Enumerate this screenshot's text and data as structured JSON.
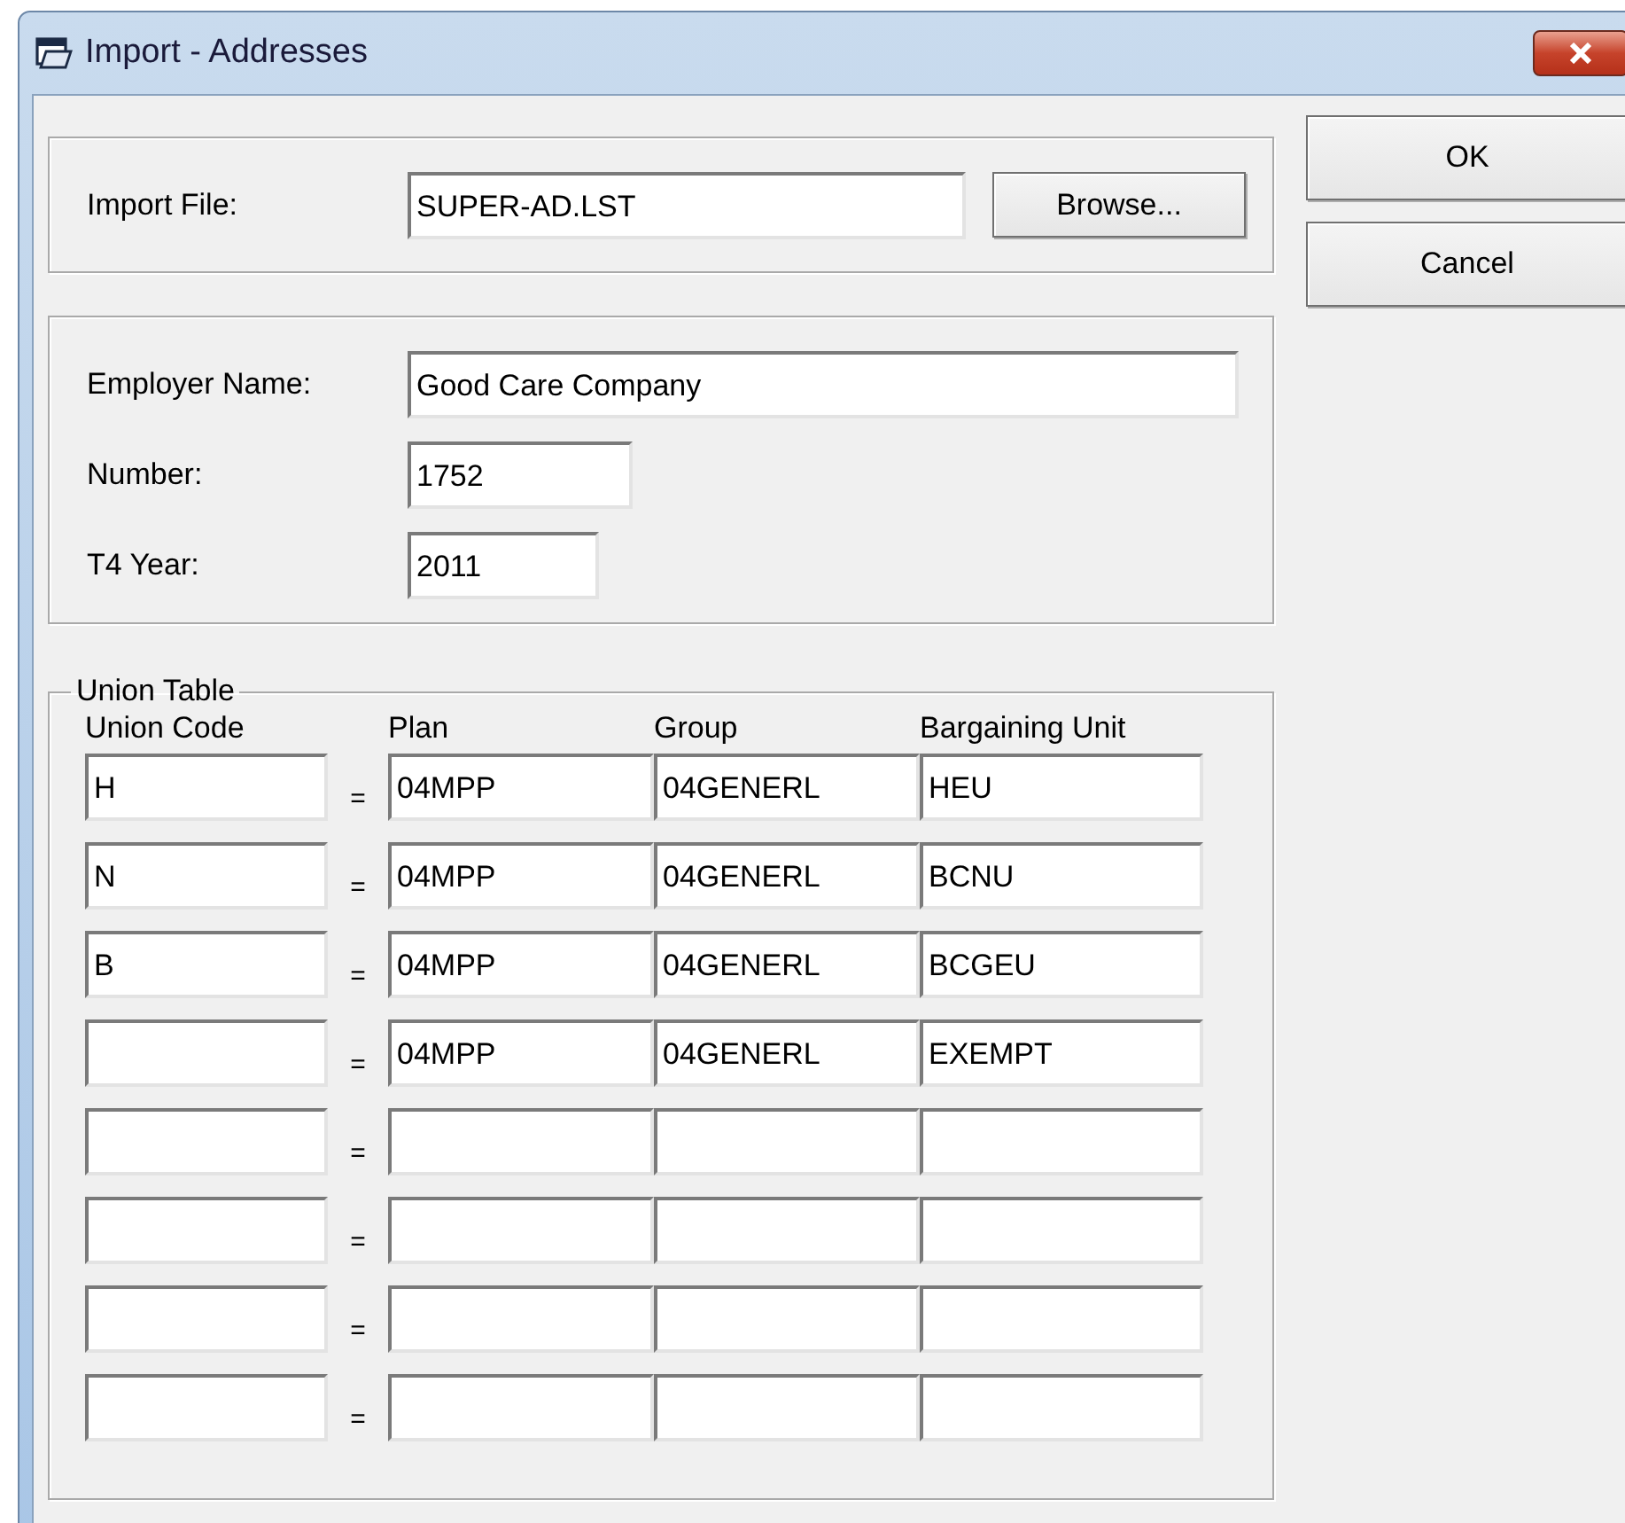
{
  "window": {
    "title": "Import - Addresses"
  },
  "import_file": {
    "label": "Import File:",
    "value": "SUPER-AD.LST",
    "browse_button": "Browse..."
  },
  "employer": {
    "name_label": "Employer Name:",
    "name": "Good Care Company",
    "number_label": "Number:",
    "number": "1752",
    "year_label": "T4 Year:",
    "year": "2011"
  },
  "union_table": {
    "title": "Union Table",
    "columns": [
      "Union Code",
      "Plan",
      "Group",
      "Bargaining Unit"
    ],
    "rows": [
      {
        "union_code": "H",
        "separator": "=",
        "plan": "04MPP",
        "group": "04GENERL",
        "bargaining_unit": "HEU"
      },
      {
        "union_code": "N",
        "separator": "=",
        "plan": "04MPP",
        "group": "04GENERL",
        "bargaining_unit": "BCNU"
      },
      {
        "union_code": "B",
        "separator": "=",
        "plan": "04MPP",
        "group": "04GENERL",
        "bargaining_unit": "BCGEU"
      },
      {
        "separator": "=",
        "plan": "04MPP",
        "group": "04GENERL",
        "bargaining_unit": "EXEMPT"
      },
      {
        "separator": "="
      },
      {
        "separator": "="
      },
      {
        "separator": "="
      },
      {
        "separator": "="
      }
    ]
  },
  "buttons": [
    "OK",
    "Cancel"
  ]
}
